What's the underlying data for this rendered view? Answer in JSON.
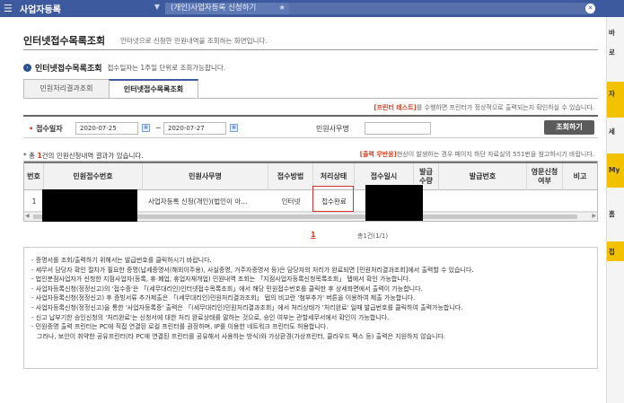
{
  "topbar": {
    "menu_label": "사업자등록",
    "breadcrumb": "(개인)사업자등록 신청하기"
  },
  "sidebar": {
    "items": [
      "바",
      "로",
      "자",
      "세",
      "My",
      "홈",
      "접"
    ]
  },
  "page": {
    "title": "인터넷접수목록조회",
    "description": "인터넷으로 신청한 민원내역을 조회하는 화면입니다."
  },
  "section": {
    "title": "인터넷접수목록조회",
    "description": "접수일자는 1주일 단위로 조회가능합니다."
  },
  "tabs": [
    {
      "label": "민원처리결과조회",
      "active": false
    },
    {
      "label": "인터넷접수목록조회",
      "active": true
    }
  ],
  "printer_notice": {
    "highlight": "[프린터 테스트]",
    "text": "를 수행하면 프린터가 정상적으로 출력되는지 확인하실 수 있습니다."
  },
  "search": {
    "date_label": "접수일자",
    "date_from": "2020-07-25",
    "date_to": "2020-07-27",
    "tilde": "~",
    "office_label": "민원사무명",
    "office_value": "",
    "query_button": "조회하기"
  },
  "results": {
    "prefix": "* 총",
    "count": "1",
    "suffix": "건의 민원신청내역 결과가 있습니다."
  },
  "copy_notice": {
    "highlight": "[출력 무반응]",
    "text": "현상이 발생하는 경우 페이지 하단 자료실의 551번을 참고하시기 바랍니다."
  },
  "table": {
    "columns": [
      "번호",
      "민원접수번호",
      "민원사무명",
      "접수방법",
      "처리상태",
      "접수일시",
      "발급\n수량",
      "발급번호",
      "영문신청\n여부",
      "비고"
    ],
    "rows": [
      {
        "no": "1",
        "receipt_no": "",
        "office_name": "사업자등록 신청(개인)(법인이 아...",
        "method": "인터넷",
        "status": "접수완료",
        "datetime": "",
        "qty": "",
        "issue_no": "",
        "english": "",
        "note": ""
      }
    ]
  },
  "pager": {
    "current": "1",
    "total": "총1건(1/1)"
  },
  "info_lines": [
    "- 증명서를 조회/출력하기 위해서는 발급번호를 클릭하시기 바랍니다.",
    "- 세무서 담당자 확인 절차가 필요한 증명(납세증명서(해외이주용), 사실증명, 거주자증명서 등)은 담당자의 처리가 완료되면 [민원처리결과조회]에서 출력할 수 있습니다.",
    "- 법인분점사업자가 신청한 지점사업자(등록, 휴·폐업, 휴업자재개업) 민원내역 조회는 「지점사업자등록신청목록조회」 탭에서 확인 가능합니다.",
    "- 사업자등록신청(정정신고)의 '접수증'은 「(세무대리인)인터넷접수목록조회」에서 해당 민원접수번호를 클릭한 후 상세화면에서 출력이 가능합니다.",
    "- 사업자등록신청(정정신고) 후 증빙서류 추가제출은 「(세무대리인)민원처리결과조회」 탭의 비고란 '첨부추가' 버튼을 이용하여 제출 가능합니다.",
    "- 사업자등록신청(정정신고)을 통한 '사업자등록증' 출력은 「(세무대리인)민원처리결과조회」에서 처리상태가 '처리완료' 일때 발급번호를 클릭하여 출력가능합니다.",
    "- 신고 납부기한 승인신청의 '처리완료'는 신청서에 대한 처리 완료상태를 말하는 것으로, 승인 여부는 관할세무서에서 확인이 가능합니다.",
    "- 민원증명 출력 프린터는 PC에 직접 연결된 로컬 프린터를 권장하며, IP를 이용한 네트워크 프린터도 허용합니다.",
    "그러나, 보안이 취약한 공유프린터(타 PC에 연결된 프린터를 공유해서 사용하는 방식)와 가상환경(가상프린터, 클라우드 팩스 등) 출력은 지원하지 않습니다."
  ],
  "colors": {
    "topbar": "#3d5a9e",
    "accent_red": "#d23c1e",
    "highlight_box": "#d93030",
    "sidebar_yellow": "#f2c200"
  }
}
